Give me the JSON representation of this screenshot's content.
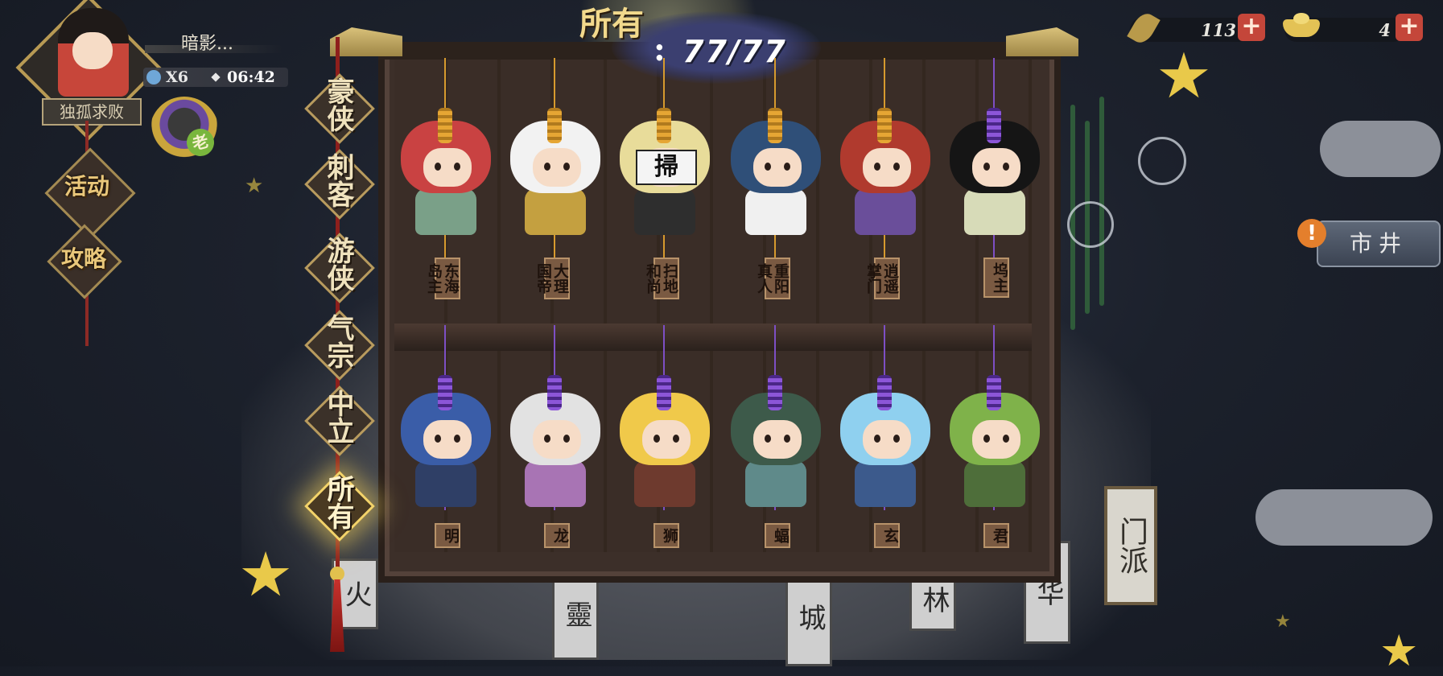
{
  "player": {
    "name": "暗影...",
    "title": "独孤求败",
    "stamina_count": "X6",
    "timer": "06:42",
    "pet_badge": "老"
  },
  "side_menu": [
    {
      "label": "活动",
      "icon": "event-icon"
    },
    {
      "label": "攻略",
      "icon": "guide-icon"
    }
  ],
  "currencies": [
    {
      "icon": "leaf-icon",
      "value": "113"
    },
    {
      "icon": "gold-ingot-icon",
      "value": "4"
    }
  ],
  "market_button": "市井",
  "sect_tag": "门派",
  "background_banners": [
    "火",
    "靈",
    "城",
    "林",
    "华"
  ],
  "categories": [
    {
      "label": "豪侠",
      "active": false
    },
    {
      "label": "刺客",
      "active": false
    },
    {
      "label": "游侠",
      "active": false
    },
    {
      "label": "气宗",
      "active": false
    },
    {
      "label": "中立",
      "active": false
    },
    {
      "label": "所有",
      "active": true
    }
  ],
  "collection": {
    "label": "所有",
    "count": "77/77"
  },
  "characters_row1": [
    {
      "name": "东海岛主",
      "head": "#c94242",
      "torso": "#7aa088",
      "beads": "gold"
    },
    {
      "name": "大理国帝",
      "head": "#f2f2f2",
      "torso": "#c4a040",
      "beads": "gold"
    },
    {
      "name": "扫地和尚",
      "head": "#e8dc9a",
      "torso": "#2e2e2e",
      "beads": "gold",
      "sign": "掃"
    },
    {
      "name": "重阳真人",
      "head": "#2f4f78",
      "torso": "#f0f0f0",
      "beads": "gold"
    },
    {
      "name": "逍遥掌门",
      "head": "#b03a2e",
      "torso": "#6a4e9a",
      "beads": "gold"
    },
    {
      "name": "坞主",
      "head": "#151515",
      "torso": "#d7dbb8",
      "beads": "purple"
    }
  ],
  "characters_row2": [
    {
      "name": "明",
      "head": "#3a5da8",
      "torso": "#2f3f66",
      "beads": "purple"
    },
    {
      "name": "龙",
      "head": "#e2e2e2",
      "torso": "#a874b4",
      "beads": "purple"
    },
    {
      "name": "狮",
      "head": "#f0c94a",
      "torso": "#6e3a2e",
      "beads": "purple"
    },
    {
      "name": "蝠",
      "head": "#3d5a4a",
      "torso": "#5f8a8a",
      "beads": "purple"
    },
    {
      "name": "玄",
      "head": "#8fd0ef",
      "torso": "#3c5a8c",
      "beads": "purple"
    },
    {
      "name": "君",
      "head": "#7fb24a",
      "torso": "#4e6e3a",
      "beads": "purple"
    }
  ]
}
